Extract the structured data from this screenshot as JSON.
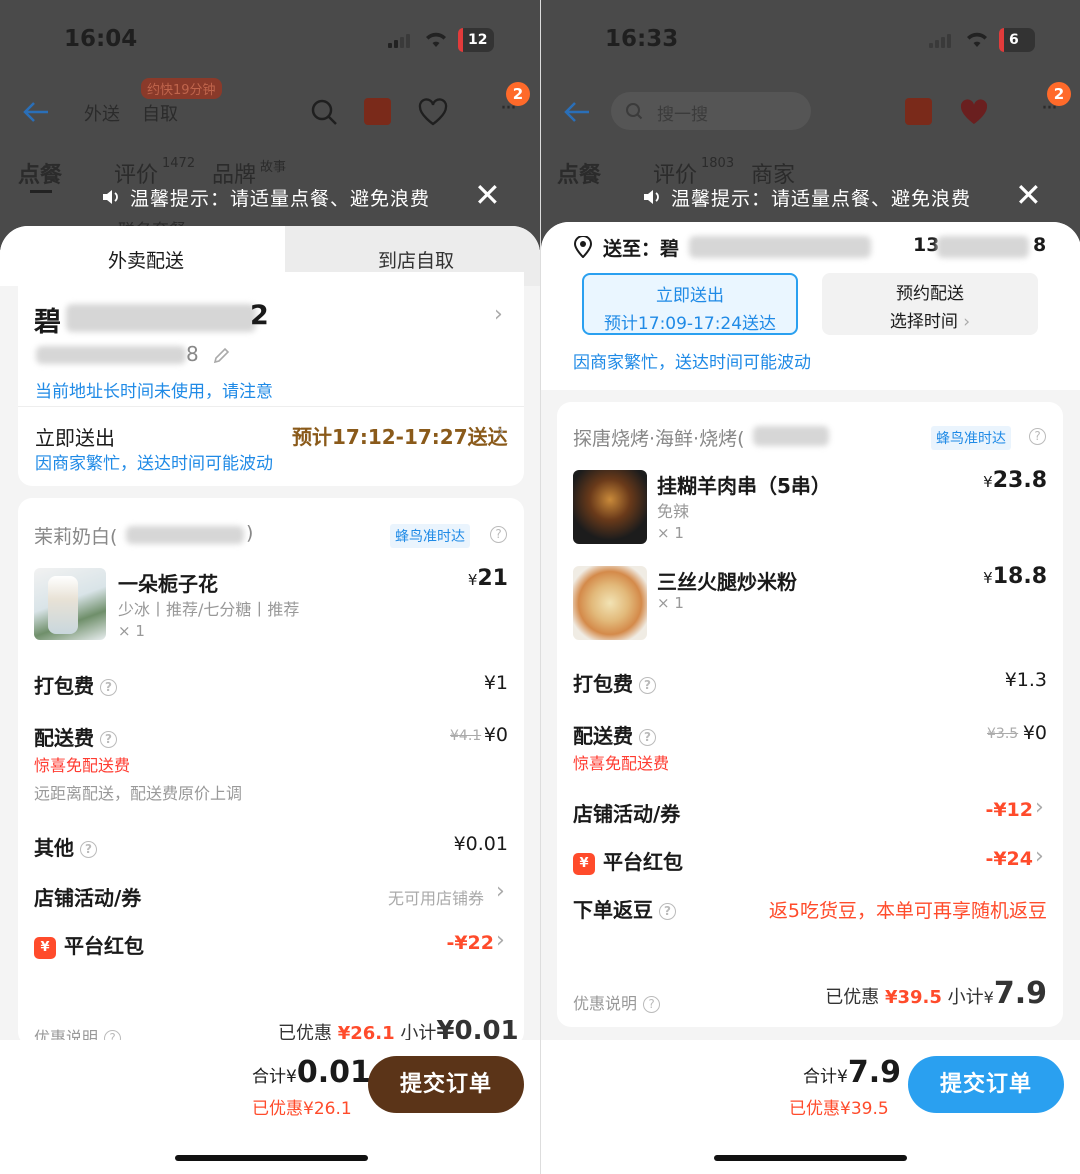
{
  "left": {
    "status": {
      "time": "16:04",
      "battery": "12"
    },
    "nav": {
      "tab_delivery": "外送",
      "tab_pickup": "自取",
      "bubble": "约快19分钟",
      "badge": "2"
    },
    "store_tabs": {
      "order": "点餐",
      "review": "评价",
      "review_count": "1472",
      "brand": "品牌",
      "brand_sub": "故事",
      "extra": "联名套餐"
    },
    "tip": "温馨提示：请适量点餐、避免浪费",
    "mode_tabs": {
      "delivery": "外卖配送",
      "pickup": "到店自取"
    },
    "address": {
      "name_first": "碧",
      "name_last": "2",
      "phone_end": "8",
      "warning": "当前地址长时间未使用，请注意"
    },
    "delivery": {
      "label": "立即送出",
      "eta": "预计17:12-17:27送达",
      "note": "因商家繁忙，送达时间可能波动"
    },
    "store": {
      "name": "茉莉奶白(",
      "name_end": ")",
      "badge": "蜂鸟准时达"
    },
    "item": {
      "name": "一朵栀子花",
      "spec": "少冰丨推荐/七分糖丨推荐",
      "qty": "× 1",
      "currency": "¥",
      "price": "21"
    },
    "pack": {
      "label": "打包费",
      "value": "¥1"
    },
    "shipping": {
      "label": "配送费",
      "orig": "¥4.1",
      "value": "¥0",
      "promo": "惊喜免配送费",
      "note": "远距离配送，配送费原价上调"
    },
    "other": {
      "label": "其他",
      "value": "¥0.01"
    },
    "coupon": {
      "label": "店铺活动/券",
      "value": "无可用店铺券"
    },
    "redpacket": {
      "icon": "¥",
      "label": "平台红包",
      "value": "-¥22"
    },
    "summary": {
      "label": "优惠说明",
      "saved_label": "已优惠",
      "saved": "¥26.1",
      "sub_label": "小计",
      "sub": "¥0.01"
    },
    "bottom": {
      "total_label": "合计¥",
      "total": "0.01",
      "saved": "已优惠¥26.1",
      "submit": "提交订单"
    }
  },
  "right": {
    "status": {
      "time": "16:33",
      "battery": "6"
    },
    "nav": {
      "search_placeholder": "搜一搜",
      "badge": "2"
    },
    "store_tabs": {
      "order": "点餐",
      "review": "评价",
      "review_count": "1803",
      "merchant": "商家"
    },
    "tip": "温馨提示：请适量点餐、避免浪费",
    "address": {
      "prefix": "送至：",
      "name_first": "碧",
      "phone_start": "13",
      "phone_end": "8"
    },
    "now": {
      "title": "立即送出",
      "eta": "预计17:09-17:24送达"
    },
    "schedule": {
      "title": "预约配送",
      "sub": "选择时间"
    },
    "delay_note": "因商家繁忙，送达时间可能波动",
    "store": {
      "name": "探唐烧烤·海鲜·烧烤(",
      "badge": "蜂鸟准时达"
    },
    "items": [
      {
        "name": "挂糊羊肉串（5串）",
        "spec": "免辣",
        "qty": "× 1",
        "currency": "¥",
        "price": "23.8"
      },
      {
        "name": "三丝火腿炒米粉",
        "spec": "",
        "qty": "× 1",
        "currency": "¥",
        "price": "18.8"
      }
    ],
    "pack": {
      "label": "打包费",
      "value": "¥1.3"
    },
    "shipping": {
      "label": "配送费",
      "orig": "¥3.5",
      "value": "¥0",
      "promo": "惊喜免配送费"
    },
    "coupon": {
      "label": "店铺活动/券",
      "value": "-¥12"
    },
    "redpacket": {
      "icon": "¥",
      "label": "平台红包",
      "value": "-¥24"
    },
    "cashback": {
      "label": "下单返豆",
      "value": "返5吃货豆，本单可再享随机返豆"
    },
    "summary": {
      "label": "优惠说明",
      "saved_label": "已优惠",
      "saved": "¥39.5",
      "sub_label": "小计",
      "sub_currency": "¥",
      "sub": "7.9"
    },
    "bottom": {
      "total_label": "合计¥",
      "total": "7.9",
      "saved": "已优惠¥39.5",
      "submit": "提交订单"
    }
  }
}
